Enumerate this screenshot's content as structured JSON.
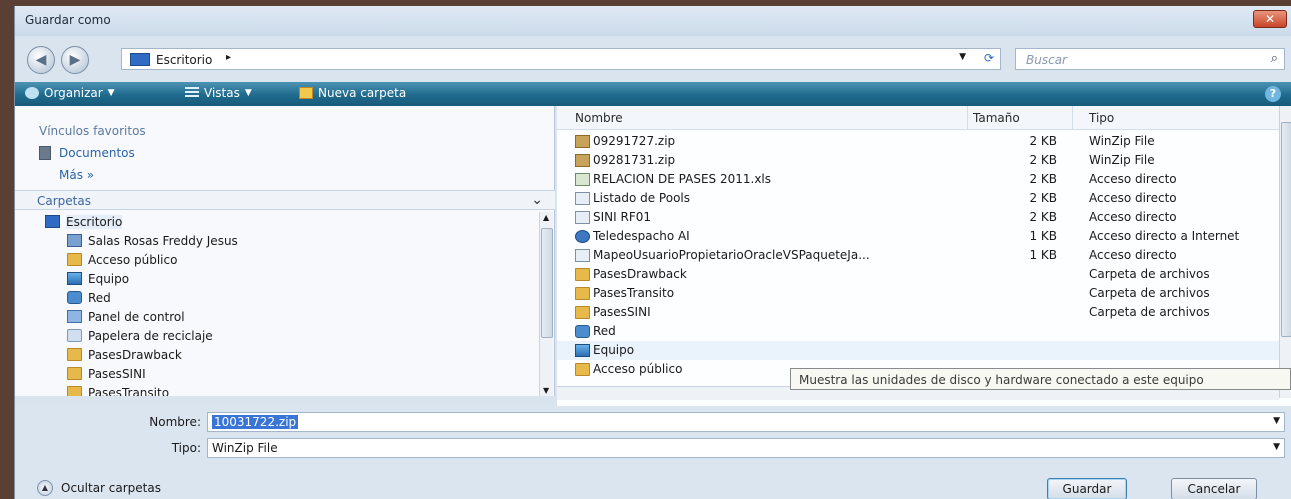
{
  "window": {
    "title": "Guardar como",
    "close_label": "✕"
  },
  "address": {
    "crumb": "Escritorio",
    "crumb_arrow": "▸",
    "search_placeholder": "Buscar"
  },
  "toolbar": {
    "organize": "Organizar",
    "views": "Vistas",
    "new_folder": "Nueva carpeta",
    "help": "?"
  },
  "favorites": {
    "title": "Vínculos favoritos",
    "items": [
      "Documentos"
    ],
    "more": "Más »"
  },
  "folders": {
    "title": "Carpetas",
    "tree": [
      {
        "label": "Escritorio",
        "icon": "desktop-icon"
      },
      {
        "label": "Salas Rosas Freddy Jesus",
        "icon": "user-folder-icon"
      },
      {
        "label": "Acceso público",
        "icon": "folder-icon"
      },
      {
        "label": "Equipo",
        "icon": "computer-icon"
      },
      {
        "label": "Red",
        "icon": "network-icon"
      },
      {
        "label": "Panel de control",
        "icon": "control-panel-icon"
      },
      {
        "label": "Papelera de reciclaje",
        "icon": "recycle-bin-icon"
      },
      {
        "label": "PasesDrawback",
        "icon": "folder-icon"
      },
      {
        "label": "PasesSINI",
        "icon": "folder-icon"
      },
      {
        "label": "PasesTransito",
        "icon": "folder-icon"
      }
    ]
  },
  "files": {
    "columns": {
      "name": "Nombre",
      "size": "Tamaño",
      "type": "Tipo"
    },
    "rows": [
      {
        "name": "09291727.zip",
        "size": "2 KB",
        "type": "WinZip File",
        "icon": "zip-icon"
      },
      {
        "name": "09281731.zip",
        "size": "2 KB",
        "type": "WinZip File",
        "icon": "zip-icon"
      },
      {
        "name": "RELACION DE PASES 2011.xls",
        "size": "2 KB",
        "type": "Acceso directo",
        "icon": "excel-shortcut-icon"
      },
      {
        "name": "Listado de Pools",
        "size": "2 KB",
        "type": "Acceso directo",
        "icon": "shortcut-icon"
      },
      {
        "name": "SINI RF01",
        "size": "2 KB",
        "type": "Acceso directo",
        "icon": "shortcut-icon"
      },
      {
        "name": "Teledespacho AI",
        "size": "1 KB",
        "type": "Acceso directo a Internet",
        "icon": "internet-shortcut-icon"
      },
      {
        "name": "MapeoUsuarioPropietarioOracleVSPaqueteJa...",
        "size": "1 KB",
        "type": "Acceso directo",
        "icon": "shortcut-icon"
      },
      {
        "name": "PasesDrawback",
        "size": "",
        "type": "Carpeta de archivos",
        "icon": "folder-icon"
      },
      {
        "name": "PasesTransito",
        "size": "",
        "type": "Carpeta de archivos",
        "icon": "folder-icon"
      },
      {
        "name": "PasesSINI",
        "size": "",
        "type": "Carpeta de archivos",
        "icon": "folder-icon"
      },
      {
        "name": "Red",
        "size": "",
        "type": "",
        "icon": "network-icon"
      },
      {
        "name": "Equipo",
        "size": "",
        "type": "",
        "icon": "computer-icon"
      },
      {
        "name": "Acceso público",
        "size": "",
        "type": "",
        "icon": "folder-icon"
      }
    ]
  },
  "tooltip": "Muestra las unidades de disco y hardware conectado a este equipo",
  "form": {
    "name_label": "Nombre:",
    "name_value": "10031722.zip",
    "type_label": "Tipo:",
    "type_value": "WinZip File"
  },
  "footer": {
    "hide_folders": "Ocultar carpetas",
    "save": "Guardar",
    "cancel": "Cancelar"
  },
  "colors": {
    "toolbar": "#1f6a8d",
    "selection": "#3875d7",
    "link": "#2a63a8"
  }
}
